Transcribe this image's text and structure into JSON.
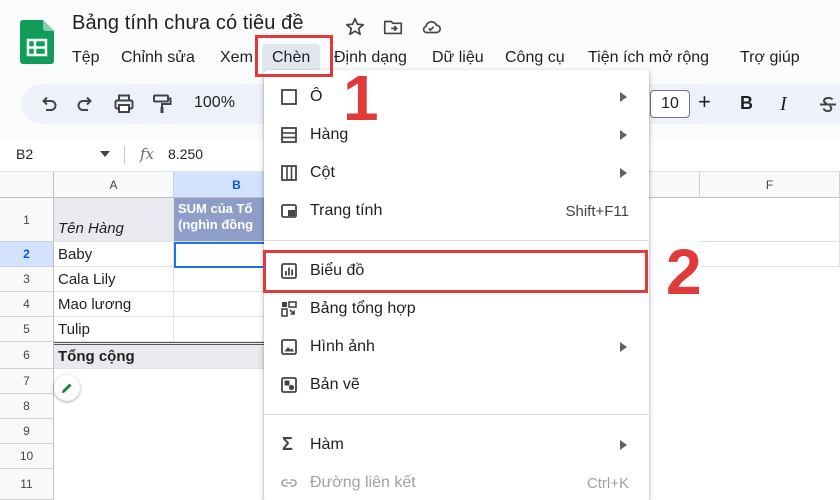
{
  "document": {
    "title": "Bảng tính chưa có tiêu đề"
  },
  "menubar": {
    "items": [
      "Tệp",
      "Chỉnh sửa",
      "Xem",
      "Chèn",
      "Định dạng",
      "Dữ liệu",
      "Công cụ",
      "Tiện ích mở rộng",
      "Trợ giúp"
    ]
  },
  "toolbar": {
    "zoom": "100%",
    "font_size": "10",
    "bold": "B",
    "italic": "I",
    "plus": "+"
  },
  "formula_bar": {
    "cell_ref": "B2",
    "fx": "fx",
    "value": "8.250"
  },
  "grid": {
    "columns": [
      "A",
      "B",
      "F"
    ],
    "rows": [
      "1",
      "2",
      "3",
      "4",
      "5",
      "6",
      "7",
      "8",
      "9",
      "10",
      "11"
    ],
    "header_a": "Tên Hàng",
    "header_b_line1": "SUM của Tổ",
    "header_b_line2": "(nghìn đồng",
    "items": [
      "Baby",
      "Cala Lily",
      "Mao lương",
      "Tulip"
    ],
    "total": "Tổng cộng"
  },
  "insert_menu": {
    "items": [
      {
        "label": "Ô",
        "submenu": true
      },
      {
        "label": "Hàng",
        "submenu": true
      },
      {
        "label": "Cột",
        "submenu": true
      },
      {
        "label": "Trang tính",
        "shortcut": "Shift+F11"
      },
      {
        "label": "Biểu đồ"
      },
      {
        "label": "Bảng tổng hợp"
      },
      {
        "label": "Hình ảnh",
        "submenu": true
      },
      {
        "label": "Bản vẽ"
      },
      {
        "label": "Hàm",
        "submenu": true
      },
      {
        "label": "Đường liên kết",
        "shortcut": "Ctrl+K",
        "disabled": true
      }
    ]
  },
  "annotations": {
    "step1": "1",
    "step2": "2",
    "color": "#e03a3a"
  },
  "colors": {
    "accent": "#1a73e8",
    "logo_green": "#0f9d58",
    "header_b_bg": "#8e9ec8"
  }
}
